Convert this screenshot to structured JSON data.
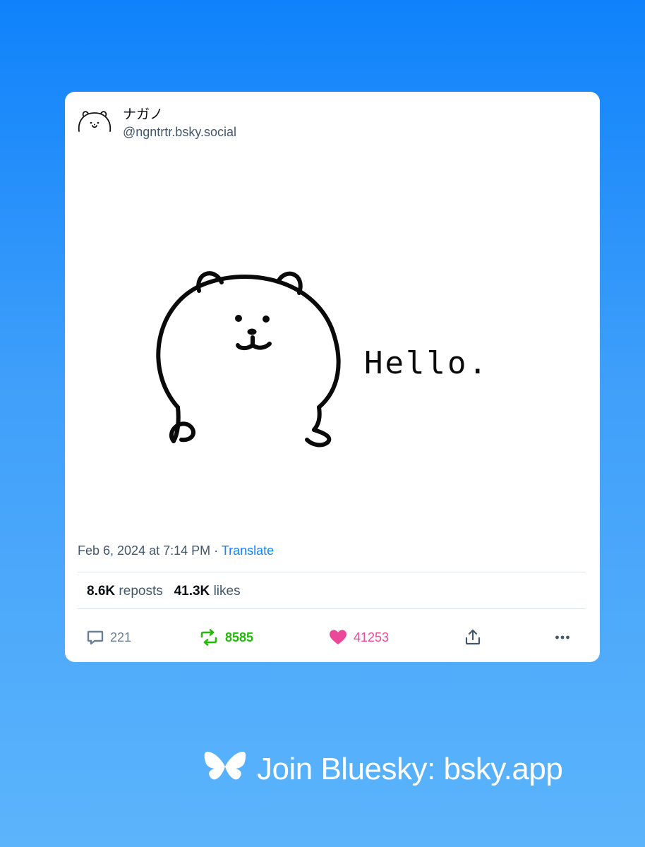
{
  "post": {
    "author": {
      "display_name": "ナガノ",
      "handle": "@ngntrtr.bsky.social",
      "avatar_icon": "bear-avatar-icon"
    },
    "image": {
      "handwritten_text": "Hello.",
      "icon": "bear-illustration"
    },
    "timestamp": "Feb 6, 2024 at 7:14 PM",
    "separator": "·",
    "translate_label": "Translate",
    "stats": {
      "reposts_count": "8.6K",
      "reposts_label": "reposts",
      "likes_count": "41.3K",
      "likes_label": "likes"
    },
    "actions": {
      "reply": {
        "count": "221",
        "icon": "reply-bubble-icon",
        "color": "#6b7f93"
      },
      "repost": {
        "count": "8585",
        "icon": "repost-icon",
        "color": "#20bc07"
      },
      "like": {
        "count": "41253",
        "icon": "heart-icon",
        "color": "#ec4899"
      },
      "share": {
        "icon": "share-icon"
      },
      "more": {
        "icon": "more-dots-icon"
      }
    }
  },
  "footer": {
    "text": "Join Bluesky: bsky.app",
    "icon": "butterfly-icon"
  },
  "colors": {
    "background_top": "#0f82fb",
    "background_bottom": "#5cb4fb",
    "link": "#1083fe",
    "muted": "#42576c"
  }
}
